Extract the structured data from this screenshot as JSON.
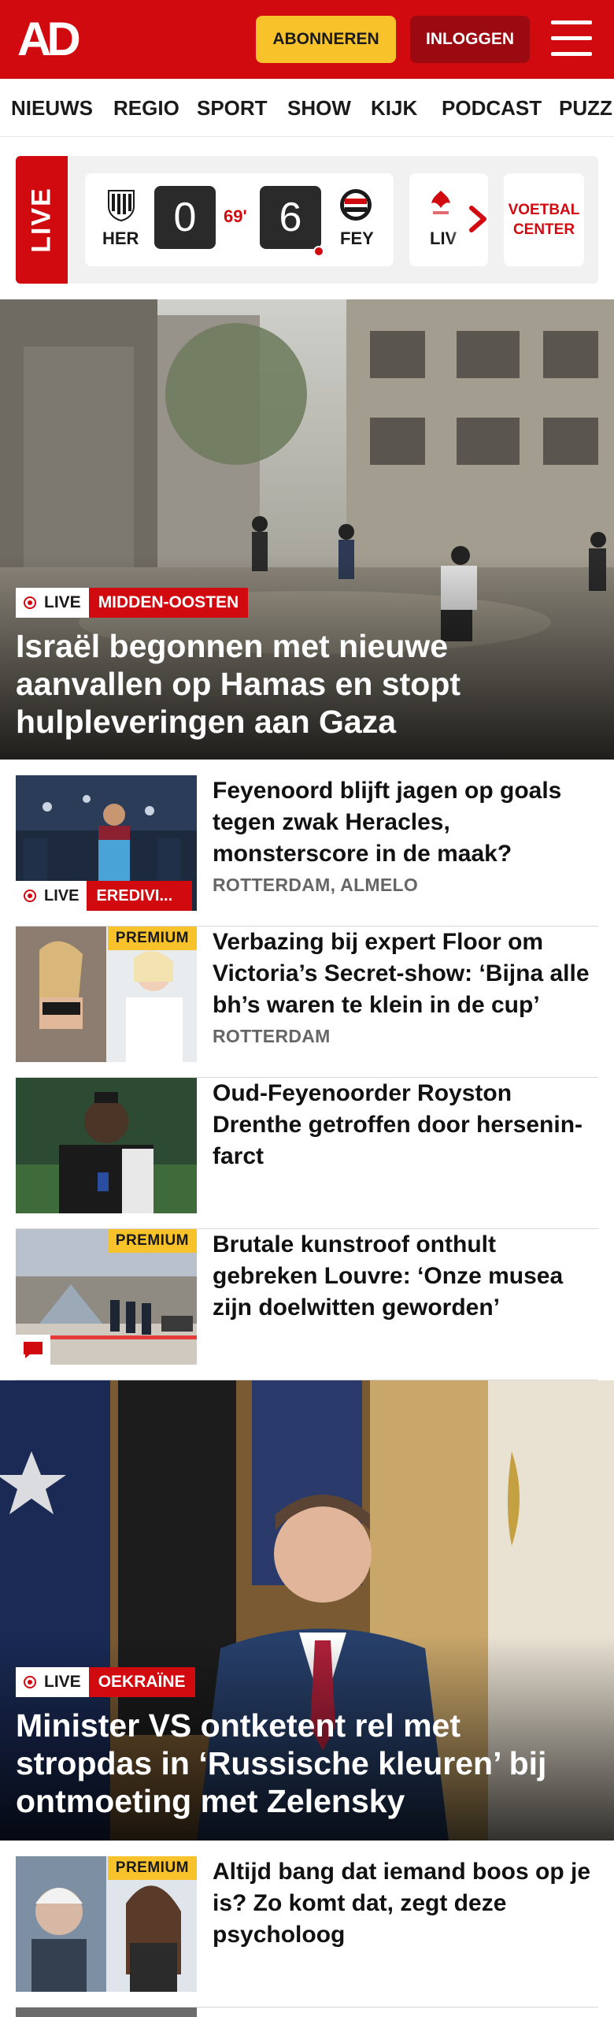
{
  "header": {
    "logo": "AD",
    "subscribe_label": "ABONNEREN",
    "login_label": "INLOGGEN",
    "menu_icon": "hamburger-icon",
    "brand_color": "#d10a10",
    "subscribe_color": "#f7c22a"
  },
  "nav": {
    "items": [
      "NIEUWS",
      "REGIO",
      "SPORT",
      "SHOW",
      "KIJK",
      "PODCAST",
      "PUZZ"
    ]
  },
  "live_scores": {
    "tag": "LIVE",
    "match": {
      "home_code": "HER",
      "away_code": "FEY",
      "home_score": "0",
      "away_score": "6",
      "minute": "69'"
    },
    "next_match_code": "LIV",
    "voetbal_center_line1": "VOETBAL",
    "voetbal_center_line2": "CENTER"
  },
  "hero": {
    "live_label": "LIVE",
    "category": "MIDDEN-OOSTEN",
    "title": "Israël begonnen met nieuwe aanvallen op Hamas en stopt hulpleveringen aan Gaza"
  },
  "articles": [
    {
      "title": "Feyenoord blijft jagen op goals tegen zwak Heracles, monsterscore in de maak?",
      "location": "ROTTERDAM, ALMELO",
      "live_label": "LIVE",
      "category": "EREDIVI..."
    },
    {
      "premium": "PREMIUM",
      "title": "Verbazing bij expert Floor om Victoria’s Secret-show: ‘Bijna alle bh’s waren te klein in de cup’",
      "location": "ROTTERDAM"
    },
    {
      "title": "Oud-Feyenoorder Royston Drenthe getroffen door hersenin-farct"
    },
    {
      "premium": "PREMIUM",
      "title": "Brutale kunstroof onthult gebreken Louvre: ‘Onze musea zijn doelwitten geworden’",
      "comment_icon": "comment-icon"
    }
  ],
  "hero2": {
    "live_label": "LIVE",
    "category": "OEKRAÏNE",
    "title": "Minister VS ontketent rel met stropdas in ‘Russische kleuren’ bij ontmoeting met Zelensky"
  },
  "article_bottom": {
    "premium": "PREMIUM",
    "title": "Altijd bang dat iemand boos op je is? Zo komt dat, zegt deze psycholoog"
  }
}
